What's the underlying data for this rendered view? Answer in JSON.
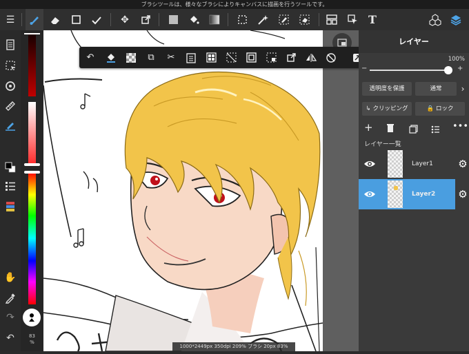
{
  "status_bar": {
    "message": "ブラシツールは、様々なブラシによりキャンバスに描画を行うツールです。"
  },
  "toolbar": {
    "menu_icon": "menu-icon",
    "items": [
      {
        "name": "brush-icon",
        "glyph": "🖌"
      },
      {
        "name": "eraser-icon",
        "glyph": "◆"
      },
      {
        "name": "square-icon",
        "glyph": "□"
      },
      {
        "name": "check-brush-icon",
        "glyph": "✓"
      },
      {
        "name": "move-icon",
        "glyph": "✥"
      },
      {
        "name": "transform-icon",
        "glyph": "⧉"
      },
      {
        "name": "fill-color-icon",
        "glyph": "■"
      },
      {
        "name": "bucket-icon",
        "glyph": "⛁"
      },
      {
        "name": "gradient-icon",
        "glyph": "▥"
      },
      {
        "name": "select-rect-icon",
        "glyph": "⬚"
      },
      {
        "name": "magic-wand-icon",
        "glyph": "✦"
      },
      {
        "name": "select-pen-icon",
        "glyph": "✎"
      },
      {
        "name": "select-eraser-icon",
        "glyph": "◇"
      },
      {
        "name": "frame-icon",
        "glyph": "▤"
      },
      {
        "name": "operation-icon",
        "glyph": "↖"
      },
      {
        "name": "text-icon",
        "glyph": "T"
      },
      {
        "name": "materials-icon",
        "glyph": "⬡"
      },
      {
        "name": "layers-icon",
        "glyph": "◈"
      }
    ]
  },
  "selection_bar": {
    "items": [
      "undo-icon",
      "clear-fill-icon",
      "transparent-icon",
      "duplicate-icon",
      "cut-icon",
      "paste-icon",
      "grid-icon",
      "deselect-icon",
      "invert-icon",
      "extract-icon",
      "transform-icon",
      "flip-icon",
      "rotate-icon",
      "close-icon",
      "more-icon"
    ]
  },
  "left_tools": [
    "pages-icon",
    "selection-icon",
    "rotate-view-icon",
    "ruler-icon",
    "brush-size-icon",
    "color-swap-icon",
    "menu-list-icon",
    "palette-icon"
  ],
  "bottom_tools": [
    "hand-icon",
    "eyedropper-icon",
    "redo-icon",
    "undo-icon"
  ],
  "zoom": {
    "value": "83",
    "unit": "%"
  },
  "layer_panel": {
    "title": "レイヤー",
    "opacity_label": "100%",
    "opacity_fraction": 0.97,
    "protect_alpha": "透明度を保護",
    "blend_mode": "通常",
    "clipping": "クリッピング",
    "lock": "ロック",
    "list_title": "レイヤー一覧",
    "layers": [
      {
        "name": "Layer1",
        "selected": false
      },
      {
        "name": "Layer2",
        "selected": true
      }
    ]
  },
  "canvas_info": "1000*2449px 350dpi 209% ブラシ 20px 83%",
  "colors": {
    "accent": "#4a9ee0",
    "hair": "#f2c44a",
    "skin": "#f8d7c4"
  }
}
